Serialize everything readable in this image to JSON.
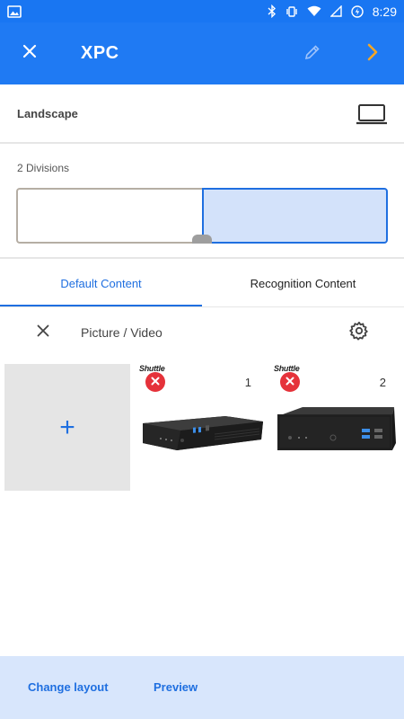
{
  "status_bar": {
    "time": "8:29",
    "icons": [
      "image-icon",
      "bluetooth-icon",
      "vibrate-icon",
      "wifi-icon",
      "signal-icon",
      "battery-charging-icon"
    ]
  },
  "app_bar": {
    "title": "XPC",
    "icons": [
      "close-icon",
      "edit-pencil-icon",
      "chevron-right-icon"
    ]
  },
  "orientation": {
    "label": "Landscape",
    "icon": "landscape-screen-icon"
  },
  "layout": {
    "divisions_label": "2 Divisions",
    "divisions": [
      {
        "id": 1,
        "selected": false
      },
      {
        "id": 2,
        "selected": true
      }
    ]
  },
  "tabs": [
    {
      "label": "Default Content",
      "active": true
    },
    {
      "label": "Recognition Content",
      "active": false
    }
  ],
  "content": {
    "type_label": "Picture / Video",
    "add_label": "+",
    "items": [
      {
        "index": "1",
        "brand": "Shuttle",
        "image": "mini-pc-slim-image"
      },
      {
        "index": "2",
        "brand": "Shuttle",
        "image": "mini-pc-cube-image"
      }
    ]
  },
  "bottom_bar": {
    "change_layout": "Change layout",
    "preview": "Preview"
  },
  "colors": {
    "primary": "#1f7af3",
    "status_bar": "#1976f2",
    "accent_orange": "#f5a623",
    "selected_division": "#d3e2fa",
    "remove_red": "#e5323a",
    "bottom_bar": "#d8e6fc"
  }
}
